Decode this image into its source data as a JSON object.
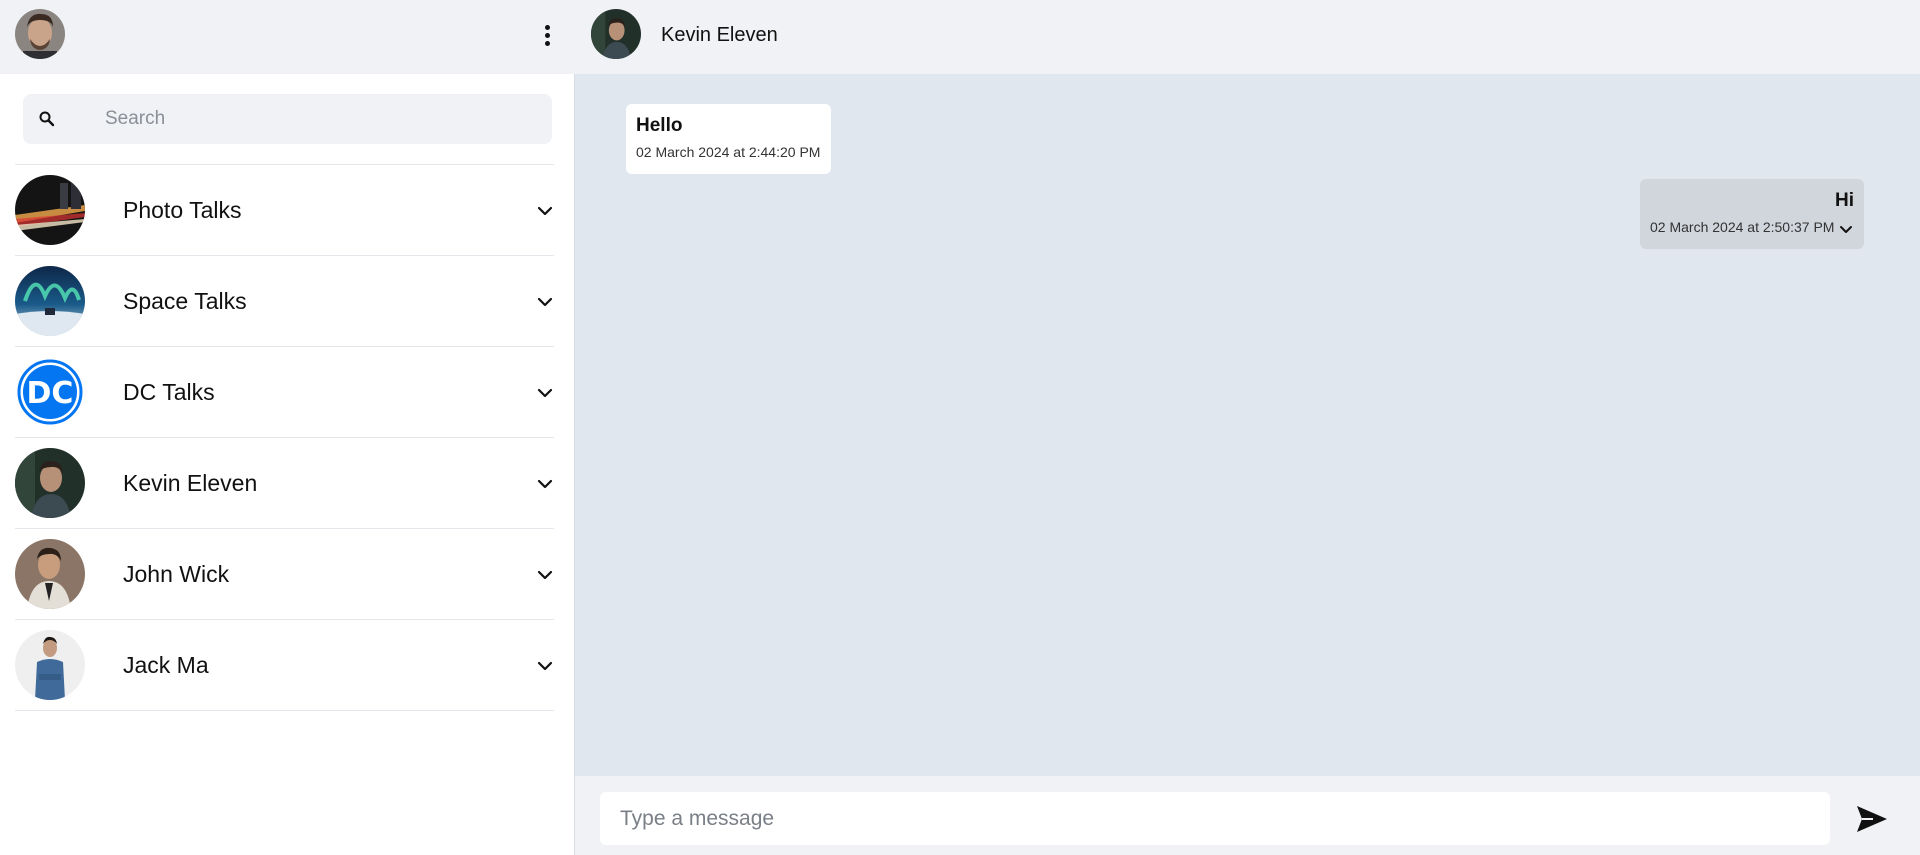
{
  "sidebar": {
    "header": {
      "my_avatar": "user-avatar",
      "menu_icon": "kebab-menu-icon"
    },
    "search": {
      "placeholder": "Search",
      "value": "",
      "icon": "search-icon"
    },
    "conversations": [
      {
        "name": "Photo Talks",
        "avatar": "city-night-photo"
      },
      {
        "name": "Space Talks",
        "avatar": "aurora-photo"
      },
      {
        "name": "DC Talks",
        "avatar": "dc-logo"
      },
      {
        "name": "Kevin Eleven",
        "avatar": "man-photo"
      },
      {
        "name": "John Wick",
        "avatar": "man-photo"
      },
      {
        "name": "Jack Ma",
        "avatar": "man-photo"
      }
    ]
  },
  "chat": {
    "peer_name": "Kevin Eleven",
    "messages": [
      {
        "direction": "incoming",
        "text": "Hello",
        "time": "02 March 2024 at 2:44:20 PM"
      },
      {
        "direction": "outgoing",
        "text": "Hi",
        "time": "02 March 2024 at 2:50:37 PM"
      }
    ],
    "composer": {
      "placeholder": "Type a message",
      "value": "",
      "send_icon": "send-icon"
    }
  },
  "colors": {
    "panel_header": "#f0f2f5",
    "chat_background": "#e1e7ef",
    "outgoing_bubble": "#d1d5dc",
    "incoming_bubble": "#ffffff",
    "dc_blue": "#0476f2"
  }
}
